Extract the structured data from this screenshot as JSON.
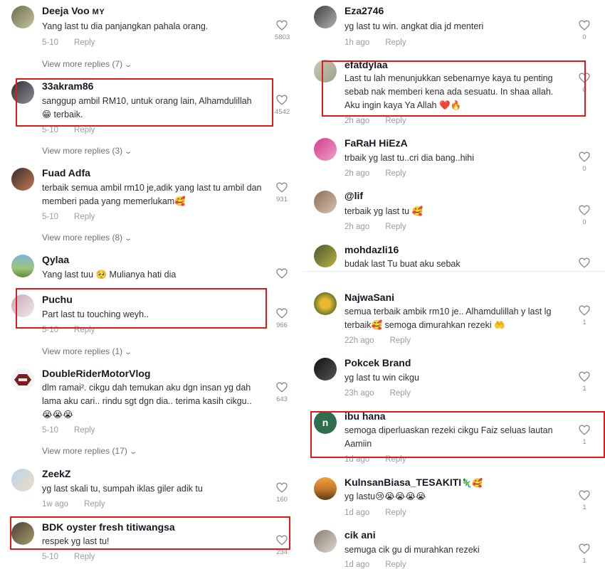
{
  "colors": {
    "highlight": "#e01a1a",
    "text": "#161823",
    "muted": "#9a9ba0"
  },
  "reply_label": "Reply",
  "left_comments": [
    {
      "user": "Deeja Voo",
      "country": "MY",
      "text": "Yang last tu dia panjangkan pahala orang.",
      "time": "5-10",
      "likes": "5803",
      "view_more": "View more replies (7)"
    },
    {
      "user": "33akram86",
      "text": "sanggup ambil RM10, untuk orang lain, Alhamdulillah 😁 terbaik.",
      "time": "5-10",
      "likes": "4542",
      "view_more": "View more replies (3)"
    },
    {
      "user": "Fuad Adfa",
      "text": "terbaik semua ambil rm10 je,adik yang last tu ambil dan memberi pada yang memerlukam🥰",
      "time": "5-10",
      "likes": "931",
      "view_more": "View more replies (8)"
    },
    {
      "user": "Qylaa",
      "text": "Yang last tuu 🥺 Mulianya hati dia",
      "time": "",
      "likes": ""
    },
    {
      "user": "Puchu",
      "text": "Part last tu touching weyh..",
      "time": "5-10",
      "likes": "966",
      "view_more": "View more replies (1)"
    },
    {
      "user": "DoubleRiderMotorVlog",
      "text": "dlm ramai². cikgu dah temukan aku dgn insan yg dah lama aku cari.. rindu sgt dgn dia.. terima kasih cikgu.. 😭😭😭",
      "time": "5-10",
      "likes": "643",
      "view_more": "View more replies (17)"
    },
    {
      "user": "ZeekZ",
      "text": "yg last skali tu, sumpah iklas giler adik tu",
      "time": "1w ago",
      "likes": "160"
    },
    {
      "user": "BDK oyster fresh titiwangsa",
      "text": "respek yg last tu!",
      "time": "5-10",
      "likes": "234"
    }
  ],
  "right_comments": [
    {
      "user": "Eza2746",
      "text": "yg last tu win. angkat dia jd menteri",
      "time": "1h ago",
      "likes": "0"
    },
    {
      "user": "efatdylaa",
      "text": "Last tu lah menunjukkan sebenarnye kaya tu penting sebab nak memberi kena ada sesuatu. In shaa allah. Aku ingin kaya Ya Allah ❤️🔥",
      "time": "2h ago",
      "likes": "0"
    },
    {
      "user": "FaRaH HiEzA",
      "text": "trbaik yg last tu..cri dia bang..hihi",
      "time": "2h ago",
      "likes": "0"
    },
    {
      "user": "@lif",
      "text": "terbaik yg last tu 🥰",
      "time": "2h ago",
      "likes": "0"
    },
    {
      "user": "mohdazli16",
      "text": "budak last Tu buat aku sebak",
      "time": "",
      "likes": ""
    },
    {
      "user": "NajwaSani",
      "text": "semua terbaik ambik rm10 je.. Alhamdulillah y last lg terbaik🥰 semoga dimurahkan rezeki 🤲",
      "time": "22h ago",
      "likes": "1"
    },
    {
      "user": "Pokcek Brand",
      "text": "yg last tu win cikgu",
      "time": "23h ago",
      "likes": "1"
    },
    {
      "user": "ibu hana",
      "avatar_letter": "n",
      "text": "semoga diperluaskan rezeki cikgu Faiz seluas lautan Aamiin",
      "time": "1d ago",
      "likes": "1"
    },
    {
      "user": "KulnsanBiasa_TESAKITI",
      "user_emoji": "🦎🥰",
      "text": "yg lastu😢😭😭😭😭",
      "time": "1d ago",
      "likes": "1"
    },
    {
      "user": "cik ani",
      "text": "semuga cik gu di murahkan rezeki",
      "time": "1d ago",
      "likes": "1"
    }
  ]
}
